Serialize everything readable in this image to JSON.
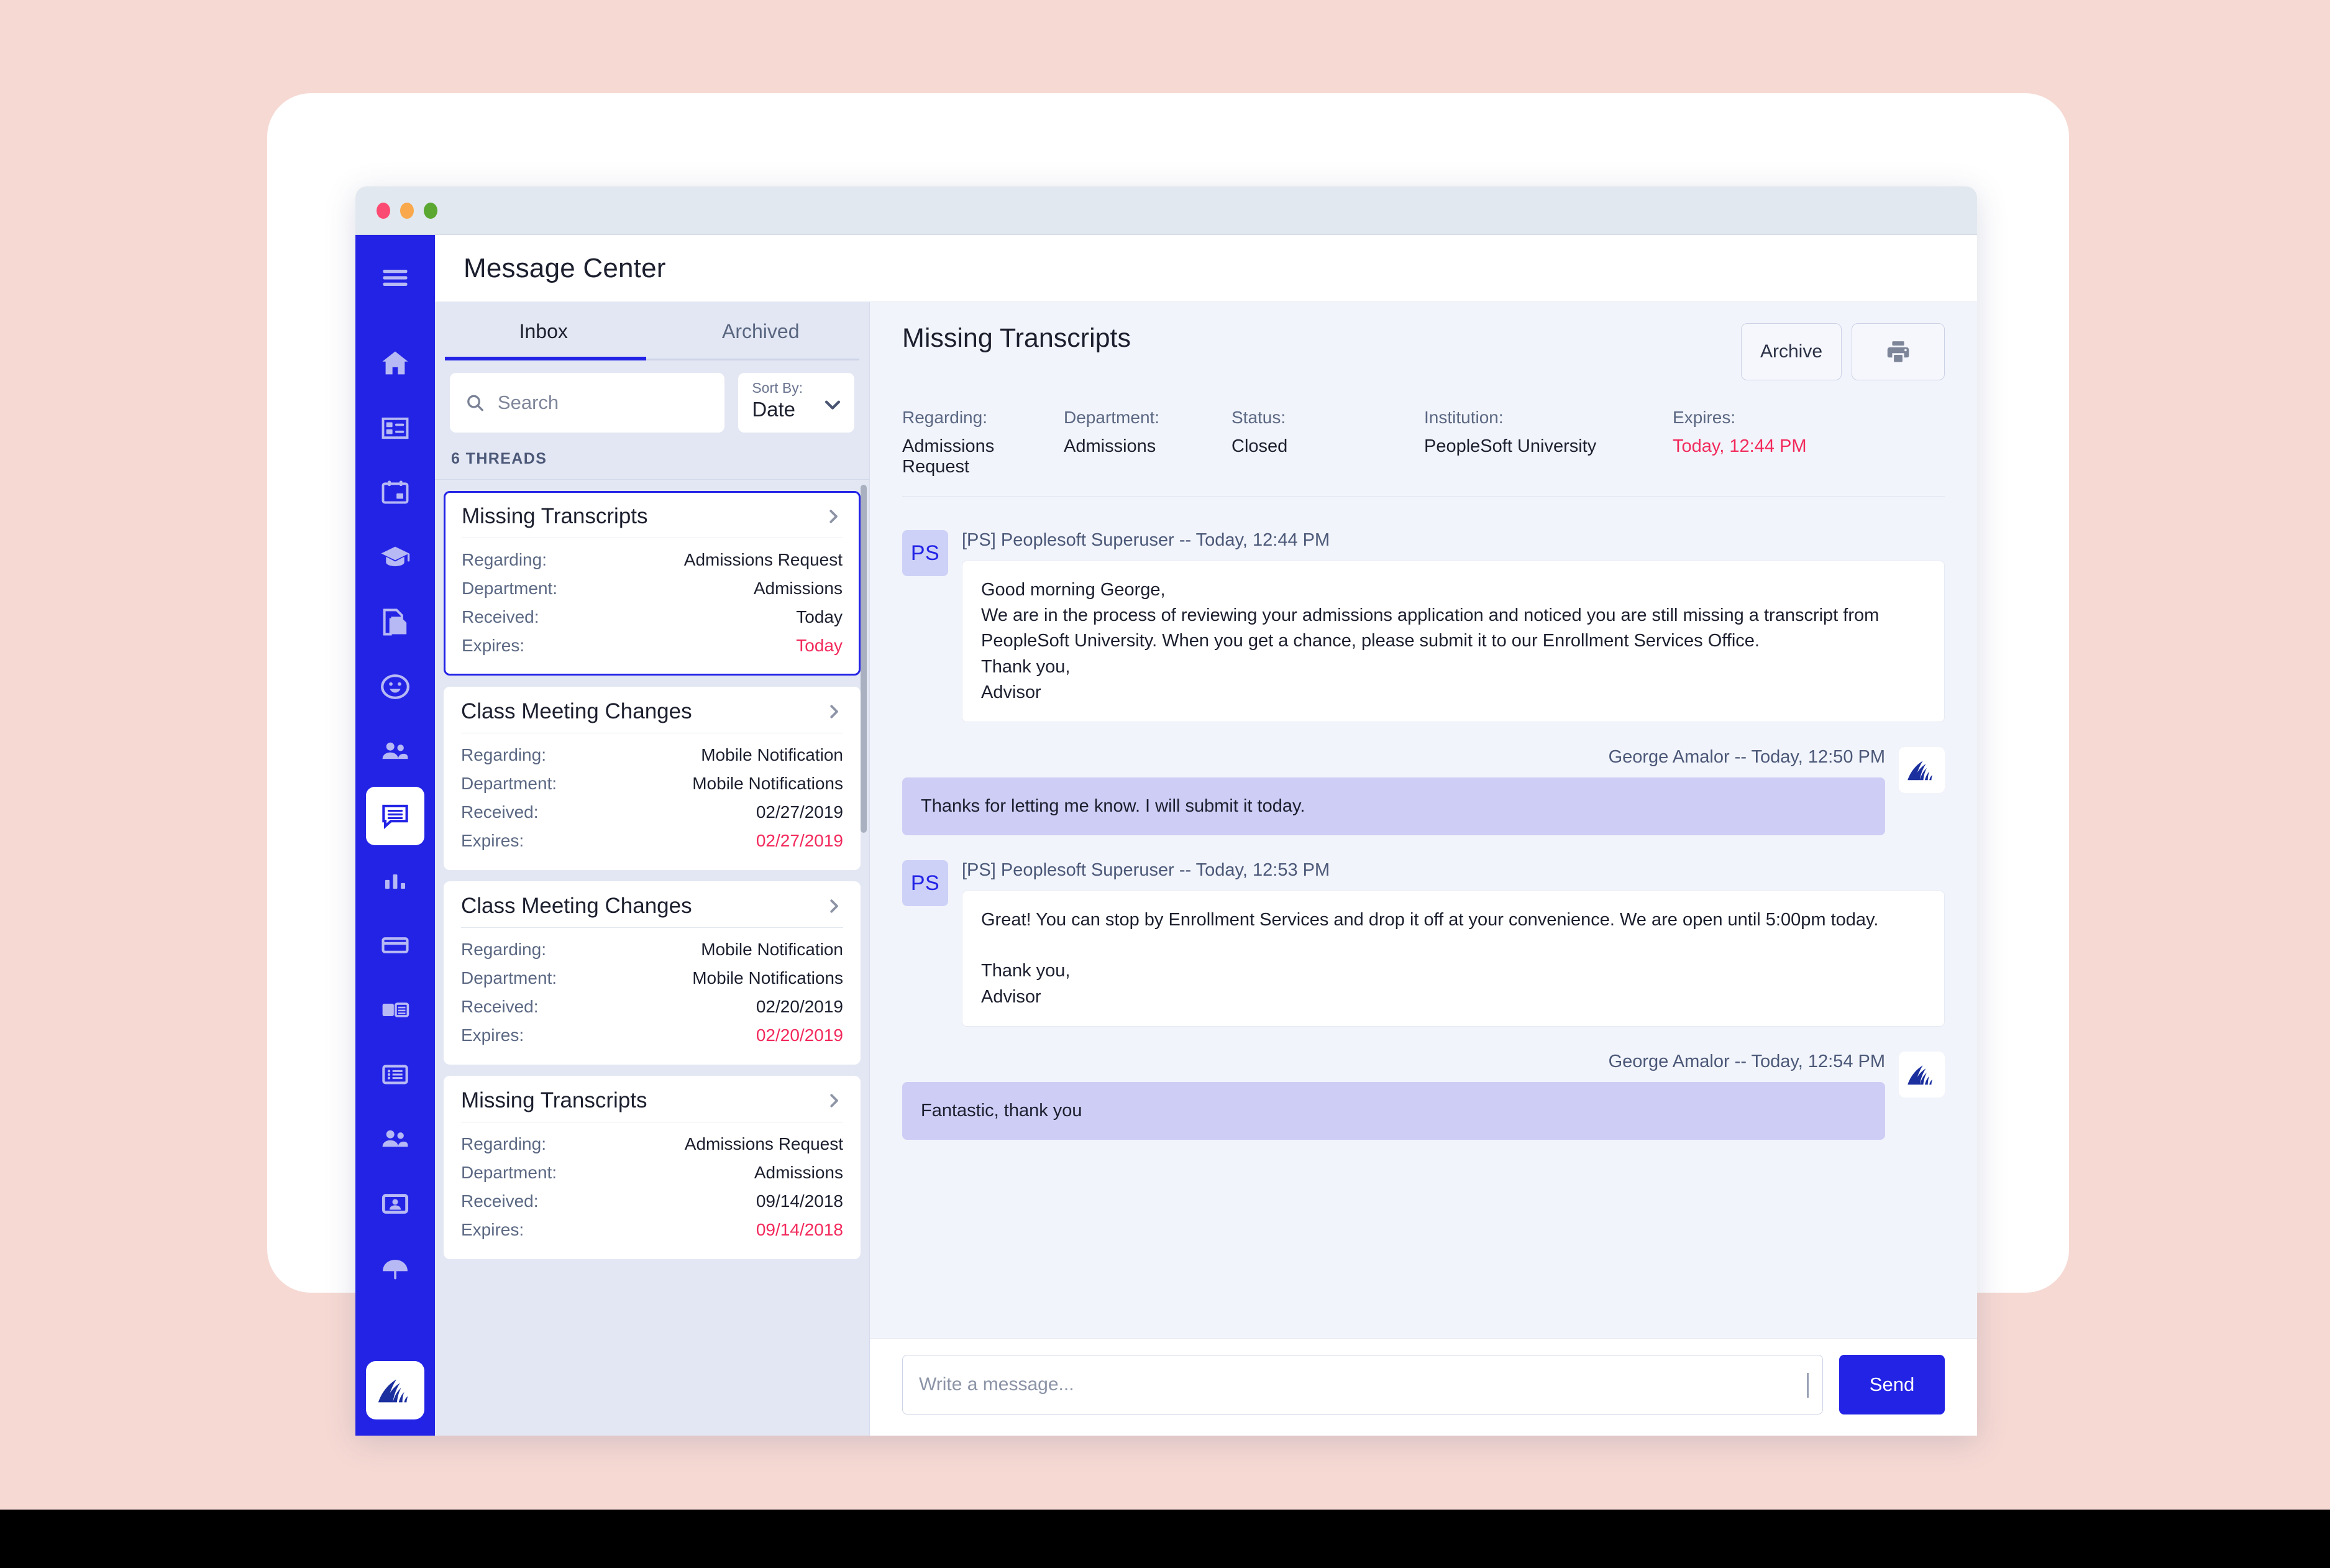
{
  "window": {
    "dots": [
      "red",
      "yellow",
      "green"
    ]
  },
  "header": {
    "title": "Message Center",
    "menu_icon": "hamburger-menu-icon"
  },
  "sidebar": {
    "items": [
      {
        "icon": "home-icon",
        "name": "home"
      },
      {
        "icon": "dashboard-card-icon",
        "name": "dashboard"
      },
      {
        "icon": "calendar-icon",
        "name": "calendar"
      },
      {
        "icon": "graduation-cap-icon",
        "name": "academics"
      },
      {
        "icon": "documents-icon",
        "name": "documents"
      },
      {
        "icon": "smiley-face-icon",
        "name": "wellness"
      },
      {
        "icon": "people-icon",
        "name": "people"
      },
      {
        "icon": "message-bubble-icon",
        "name": "message-center",
        "active": true
      },
      {
        "icon": "bar-chart-icon",
        "name": "analytics"
      },
      {
        "icon": "card-icon",
        "name": "financials"
      },
      {
        "icon": "news-panel-icon",
        "name": "news"
      },
      {
        "icon": "list-icon",
        "name": "list"
      },
      {
        "icon": "people-group-icon",
        "name": "groups"
      },
      {
        "icon": "id-card-icon",
        "name": "profile-card"
      },
      {
        "icon": "umbrella-icon",
        "name": "support"
      }
    ],
    "logo_icon": "peoplesoft-mountain-logo"
  },
  "tabs": [
    {
      "label": "Inbox",
      "active": true
    },
    {
      "label": "Archived",
      "active": false
    }
  ],
  "search": {
    "placeholder": "Search",
    "value": "",
    "icon": "search-icon"
  },
  "sort": {
    "label": "Sort By:",
    "value": "Date",
    "icon": "chevron-down-icon"
  },
  "threads_count": "6 THREADS",
  "threads": [
    {
      "title": "Missing Transcripts",
      "selected": true,
      "rows": [
        {
          "key": "Regarding:",
          "value": "Admissions Request"
        },
        {
          "key": "Department:",
          "value": "Admissions"
        },
        {
          "key": "Received:",
          "value": "Today"
        },
        {
          "key": "Expires:",
          "value": "Today",
          "expire": true
        }
      ]
    },
    {
      "title": "Class Meeting Changes",
      "selected": false,
      "rows": [
        {
          "key": "Regarding:",
          "value": "Mobile Notification"
        },
        {
          "key": "Department:",
          "value": "Mobile Notifications"
        },
        {
          "key": "Received:",
          "value": "02/27/2019"
        },
        {
          "key": "Expires:",
          "value": "02/27/2019",
          "expire": true
        }
      ]
    },
    {
      "title": "Class Meeting Changes",
      "selected": false,
      "rows": [
        {
          "key": "Regarding:",
          "value": "Mobile Notification"
        },
        {
          "key": "Department:",
          "value": "Mobile Notifications"
        },
        {
          "key": "Received:",
          "value": "02/20/2019"
        },
        {
          "key": "Expires:",
          "value": "02/20/2019",
          "expire": true
        }
      ]
    },
    {
      "title": "Missing Transcripts",
      "selected": false,
      "rows": [
        {
          "key": "Regarding:",
          "value": "Admissions Request"
        },
        {
          "key": "Department:",
          "value": "Admissions"
        },
        {
          "key": "Received:",
          "value": "09/14/2018"
        },
        {
          "key": "Expires:",
          "value": "09/14/2018",
          "expire": true
        }
      ]
    }
  ],
  "detail": {
    "title": "Missing Transcripts",
    "archive_label": "Archive",
    "print_icon": "printer-icon",
    "meta": [
      {
        "key": "Regarding:",
        "value": "Admissions Request"
      },
      {
        "key": "Department:",
        "value": "Admissions"
      },
      {
        "key": "Status:",
        "value": "Closed"
      },
      {
        "key": "Institution:",
        "value": "PeopleSoft University"
      },
      {
        "key": "Expires:",
        "value": "Today, 12:44 PM",
        "expire": true
      }
    ],
    "messages": [
      {
        "direction": "in",
        "avatar_initials": "PS",
        "meta": "[PS] Peoplesoft Superuser -- Today, 12:44 PM",
        "lines": [
          "Good morning George,",
          "We are in the process of reviewing your admissions application and noticed you are still missing a transcript from PeopleSoft University. When you get a chance, please submit it to our Enrollment Services Office.",
          "Thank you,",
          "Advisor"
        ]
      },
      {
        "direction": "out",
        "avatar_icon": "peoplesoft-mountain-logo",
        "meta": "George Amalor -- Today, 12:50 PM",
        "lines": [
          "Thanks for letting me know. I will submit it today."
        ]
      },
      {
        "direction": "in",
        "avatar_initials": "PS",
        "meta": "[PS] Peoplesoft Superuser -- Today, 12:53 PM",
        "lines": [
          "Great! You can stop by Enrollment Services and drop it off at your convenience. We are open until 5:00pm today.",
          "",
          "Thank you,",
          "Advisor"
        ]
      },
      {
        "direction": "out",
        "avatar_icon": "peoplesoft-mountain-logo",
        "meta": "George Amalor -- Today, 12:54 PM",
        "lines": [
          "Fantastic, thank you"
        ]
      }
    ]
  },
  "composer": {
    "placeholder": "Write a message...",
    "value": "",
    "send_label": "Send"
  },
  "colors": {
    "brand_blue": "#2323e6",
    "page_pink": "#f6d9d3",
    "expire_red": "#f2295b",
    "bubble_out": "#cdcdf5",
    "logo_navy": "#1b2f9e"
  }
}
